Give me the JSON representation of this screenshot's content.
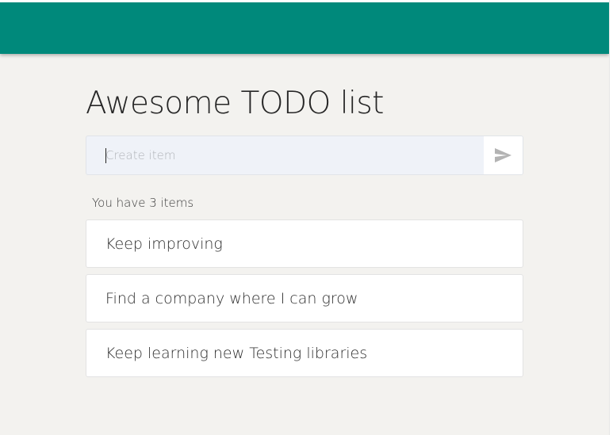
{
  "header": {
    "color": "#00897b"
  },
  "main": {
    "title": "Awesome TODO list",
    "create": {
      "placeholder": "Create item",
      "value": "",
      "submit_icon": "send-icon"
    },
    "count_text": "You have 3 items",
    "items": [
      {
        "text": "Keep improving"
      },
      {
        "text": "Find a company where I can grow"
      },
      {
        "text": "Keep learning new Testing libraries"
      }
    ]
  },
  "colors": {
    "accent": "#00897b",
    "background": "#f3f2ef",
    "input_background": "#eff2f8",
    "card": "#ffffff"
  }
}
